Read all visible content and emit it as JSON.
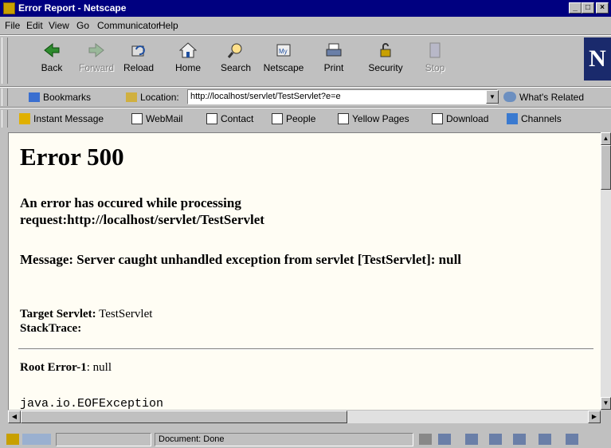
{
  "window": {
    "title": "Error Report - Netscape"
  },
  "menu": [
    "File",
    "Edit",
    "View",
    "Go",
    "Communicator",
    "Help"
  ],
  "toolbar": [
    {
      "label": "Back",
      "icon": "back-arrow-icon",
      "enabled": true
    },
    {
      "label": "Forward",
      "icon": "forward-arrow-icon",
      "enabled": false
    },
    {
      "label": "Reload",
      "icon": "reload-icon",
      "enabled": true
    },
    {
      "label": "Home",
      "icon": "home-icon",
      "enabled": true
    },
    {
      "label": "Search",
      "icon": "search-icon",
      "enabled": true
    },
    {
      "label": "Netscape",
      "icon": "my-netscape-icon",
      "enabled": true
    },
    {
      "label": "Print",
      "icon": "print-icon",
      "enabled": true
    },
    {
      "label": "Security",
      "icon": "lock-icon",
      "enabled": true
    },
    {
      "label": "Stop",
      "icon": "stop-icon",
      "enabled": false
    }
  ],
  "logo": "N",
  "location": {
    "bookmarks_label": "Bookmarks",
    "location_label": "Location:",
    "url": "http://localhost/servlet/TestServlet?e=e",
    "whats_related": "What's Related"
  },
  "personal_toolbar": [
    "Instant Message",
    "WebMail",
    "Contact",
    "People",
    "Yellow Pages",
    "Download",
    "Channels"
  ],
  "page": {
    "heading": "Error 500",
    "error_line1": "An error has occured while processing",
    "error_line2": "request:http://localhost/servlet/TestServlet",
    "message": "Message: Server caught unhandled exception from servlet [TestServlet]: null",
    "target_label": "Target Servlet:",
    "target_value": "TestServlet",
    "stacktrace_label": "StackTrace:",
    "root_error_label": "Root Error-1",
    "root_error_value": ": null",
    "exception": "java.io.EOFException"
  },
  "status": {
    "text": "Document: Done"
  },
  "colors": {
    "titlebar": "#000080",
    "chrome": "#c0c0c0",
    "page_bg": "#fffdf4"
  }
}
